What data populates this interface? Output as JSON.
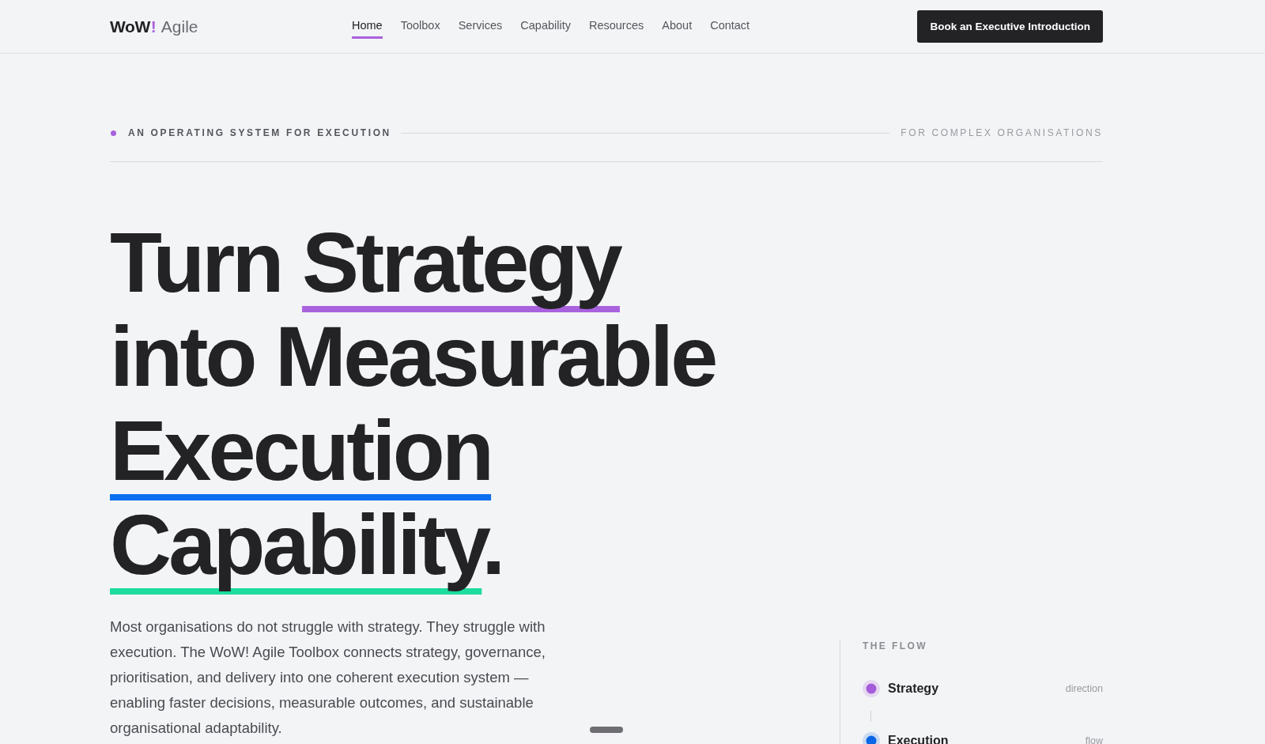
{
  "header": {
    "logo": {
      "mark": "WoW",
      "accent": "!",
      "name": "Agile"
    },
    "nav": [
      {
        "label": "Home",
        "selected": true
      },
      {
        "label": "Toolbox",
        "selected": false
      },
      {
        "label": "Services",
        "selected": false
      },
      {
        "label": "Capability",
        "selected": false
      },
      {
        "label": "Resources",
        "selected": false
      },
      {
        "label": "About",
        "selected": false
      },
      {
        "label": "Contact",
        "selected": false
      }
    ],
    "cta": "Book an Executive Introduction"
  },
  "eyebrow": {
    "left": "AN OPERATING SYSTEM FOR EXECUTION",
    "right": "FOR COMPLEX ORGANISATIONS"
  },
  "hero": {
    "headline": [
      [
        {
          "text": "Turn "
        },
        {
          "text": "Strategy",
          "color": "#a962de"
        }
      ],
      [
        {
          "text": "into Measurable"
        }
      ],
      [
        {
          "text": "Execution",
          "color": "#0b6ff0"
        }
      ],
      [
        {
          "text": "Capability",
          "color": "#1edc9d"
        },
        {
          "text": "."
        }
      ]
    ],
    "lede": "Most organisations do not struggle with strategy. They struggle with execution. The WoW! Agile Toolbox connects strategy, governance, prioritisation, and delivery into one coherent execution system — enabling faster decisions, measurable outcomes, and sustainable organisational adaptability."
  },
  "flow": {
    "title": "THE FLOW",
    "items": [
      {
        "name": "Strategy",
        "note": "direction",
        "color": "#a45bd9"
      },
      {
        "name": "Execution",
        "note": "flow",
        "color": "#0a66e6"
      }
    ]
  }
}
